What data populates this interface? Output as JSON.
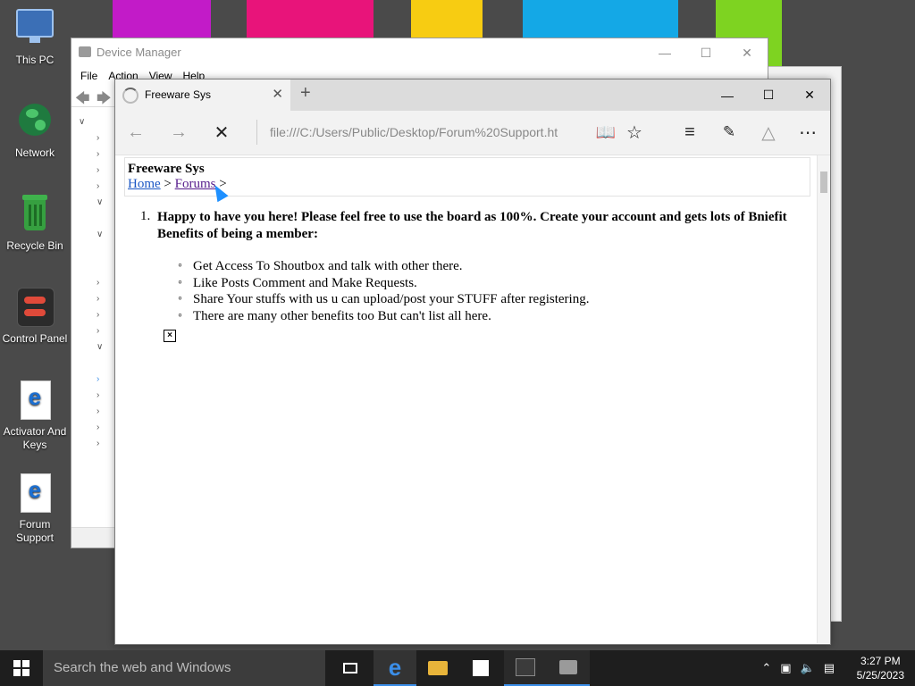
{
  "desktop": {
    "icons": [
      {
        "label": "This PC",
        "icon": "computer-icon"
      },
      {
        "label": "Network",
        "icon": "globe-icon"
      },
      {
        "label": "Recycle Bin",
        "icon": "recycle-bin-icon"
      },
      {
        "label": "Control Panel",
        "icon": "control-panel-icon"
      },
      {
        "label": "Activator And Keys",
        "icon": "edge-file-icon"
      },
      {
        "label": "Forum Support",
        "icon": "edge-file-icon"
      }
    ],
    "wallpaper_colors": [
      "#c21bc8",
      "#e8147a",
      "#f7cc12",
      "#14a8e6",
      "#7ed321"
    ]
  },
  "device_manager": {
    "title": "Device Manager",
    "menu": [
      "File",
      "Action",
      "View",
      "Help"
    ]
  },
  "browser": {
    "tab_title": "Freeware Sys",
    "new_tab_symbol": "+",
    "address": "file:///C:/Users/Public/Desktop/Forum%20Support.ht",
    "page": {
      "site_title": "Freeware Sys",
      "breadcrumb": {
        "home": "Home",
        "forums": "Forums",
        "sep": ">"
      },
      "post_number": "1.",
      "headline": "Happy to have you here! Please feel free to use the board as 100%. Create your account and gets lots of Bniefit Benefits of being a member:",
      "benefits": [
        "Get Access To Shoutbox and talk with other there.",
        "Like Posts Comment and Make Requests.",
        "Share Your stuffs with us u can upload/post your STUFF after registering.",
        "There are many other benefits too But can't list all here."
      ]
    }
  },
  "taskbar": {
    "search_placeholder": "Search the web and Windows",
    "time": "3:27 PM",
    "date": "5/25/2023",
    "accent": "#3b8ee8"
  }
}
